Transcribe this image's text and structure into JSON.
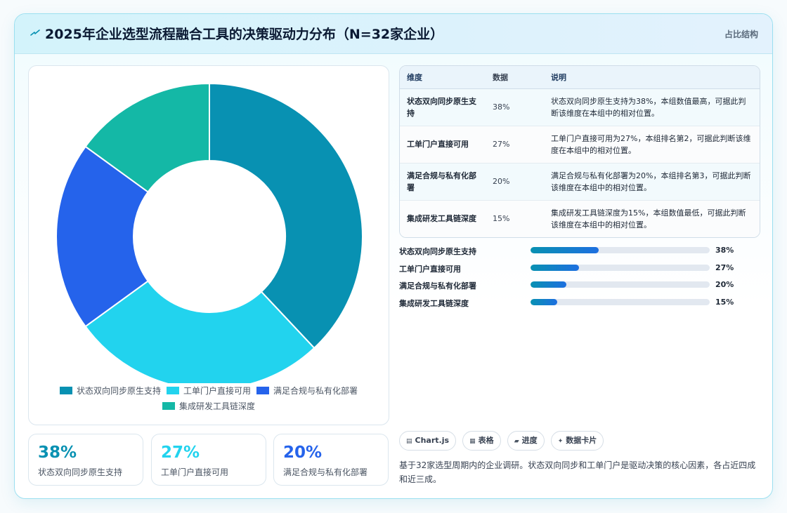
{
  "header": {
    "icon": "bolt-icon",
    "title": "2025年企业选型流程融合工具的决策驱动力分布（N=32家企业）",
    "tag": "占比结构"
  },
  "chart_data": {
    "type": "pie",
    "variant": "donut",
    "categories": [
      "状态双向同步原生支持",
      "工单门户直接可用",
      "满足合规与私有化部署",
      "集成研发工具链深度"
    ],
    "values": [
      38,
      27,
      20,
      15
    ],
    "unit": "%",
    "colors": [
      "#0891b2",
      "#22d3ee",
      "#2563eb",
      "#14b8a6"
    ],
    "legend_position": "bottom"
  },
  "stats": [
    {
      "value": "38%",
      "label": "状态双向同步原生支持",
      "color": "#0891b2"
    },
    {
      "value": "27%",
      "label": "工单门户直接可用",
      "color": "#22d3ee"
    },
    {
      "value": "20%",
      "label": "满足合规与私有化部署",
      "color": "#2563eb"
    }
  ],
  "table": {
    "headers": [
      "维度",
      "数据",
      "说明"
    ],
    "rows": [
      [
        "状态双向同步原生支持",
        "38%",
        "状态双向同步原生支持为38%，本组数值最高，可据此判断该维度在本组中的相对位置。"
      ],
      [
        "工单门户直接可用",
        "27%",
        "工单门户直接可用为27%，本组排名第2，可据此判断该维度在本组中的相对位置。"
      ],
      [
        "满足合规与私有化部署",
        "20%",
        "满足合规与私有化部署为20%，本组排名第3，可据此判断该维度在本组中的相对位置。"
      ],
      [
        "集成研发工具链深度",
        "15%",
        "集成研发工具链深度为15%，本组数值最低，可据此判断该维度在本组中的相对位置。"
      ]
    ]
  },
  "progress": [
    {
      "label": "状态双向同步原生支持",
      "value": 38,
      "text": "38%"
    },
    {
      "label": "工单门户直接可用",
      "value": 27,
      "text": "27%"
    },
    {
      "label": "满足合规与私有化部署",
      "value": 20,
      "text": "20%"
    },
    {
      "label": "集成研发工具链深度",
      "value": 15,
      "text": "15%"
    }
  ],
  "progress_max": 100,
  "chips": [
    {
      "icon": "chart-icon",
      "glyph": "▤",
      "label": "Chart.js"
    },
    {
      "icon": "table-icon",
      "glyph": "▦",
      "label": "表格"
    },
    {
      "icon": "progress-icon",
      "glyph": "▰",
      "label": "进度"
    },
    {
      "icon": "sparkle-icon",
      "glyph": "✦",
      "label": "数据卡片"
    }
  ],
  "note": "基于32家选型周期内的企业调研。状态双向同步和工单门户是驱动决策的核心因素，各占近四成和近三成。"
}
